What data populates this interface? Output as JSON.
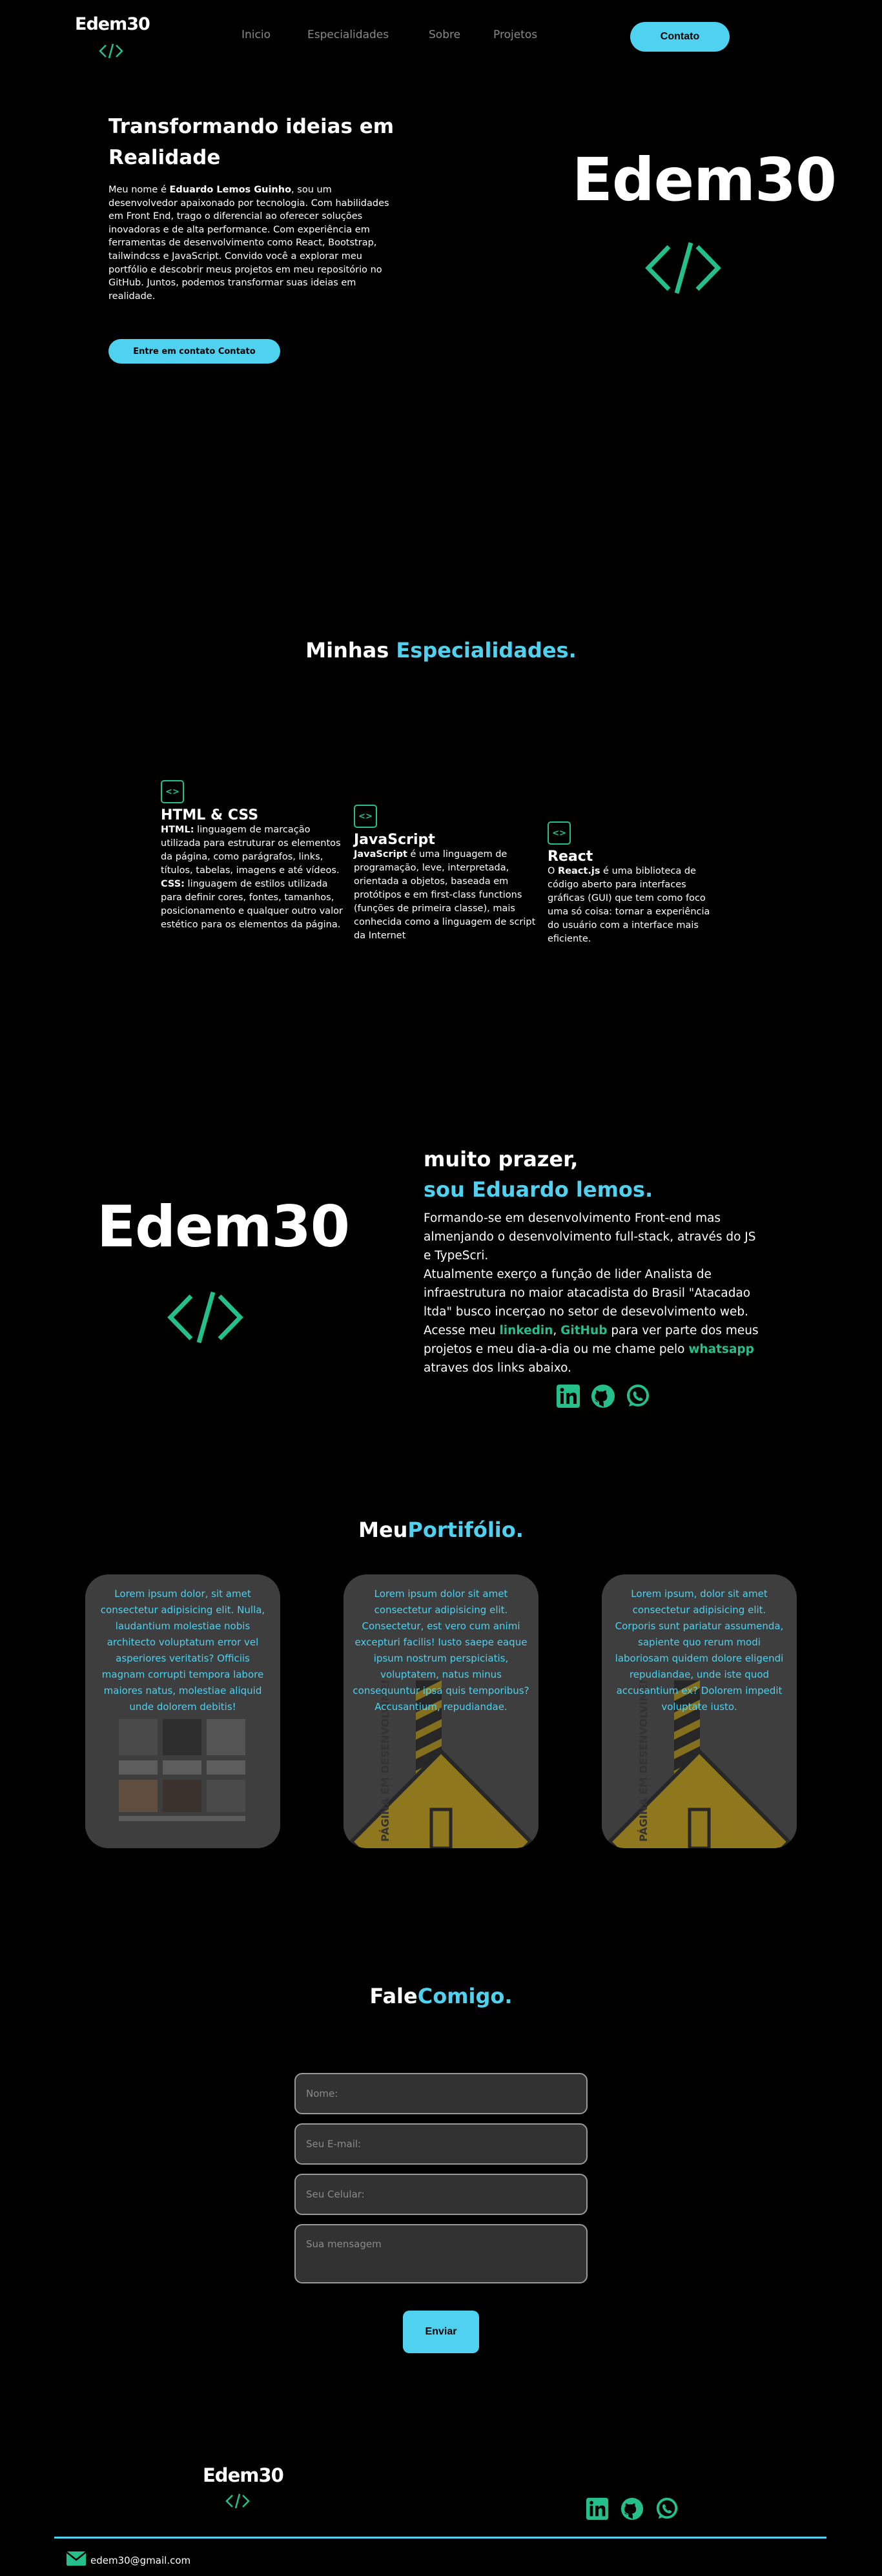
{
  "header": {
    "logo": "Edem30",
    "nav": [
      "Inicio",
      "Especialidades",
      "Sobre",
      "Projetos"
    ],
    "contact_button": "Contato"
  },
  "hero": {
    "title": "Transformando ideias em Realidade",
    "intro_prefix": "Meu nome é",
    "name": "Eduardo Lemos Guinho",
    "intro_rest": ", sou um desenvolvedor apaixonado por tecnologia. Com habilidades em Front End, trago o diferencial ao oferecer soluções inovadoras e de alta performance. Com experiência em ferramentas de desenvolvimento como React, Bootstrap, tailwindcss e JavaScript. Convido você a explorar meu portfólio e descobrir meus projetos em meu repositório no GitHub. Juntos, podemos transformar suas ideias em realidade.",
    "button": "Entre em contato Contato",
    "logo": "Edem30"
  },
  "specialties": {
    "title_white": "Minhas",
    "title_accent": "Especialidades.",
    "items": [
      {
        "icon": "code-icon",
        "title": "HTML & CSS",
        "p1_strong": "HTML:",
        "p1": " linguagem de marcação utilizada para estruturar os elementos da página, como parágrafos, links, títulos, tabelas, imagens e até vídeos.",
        "p2_strong": "CSS:",
        "p2": " linguagem de estilos utilizada para definir cores, fontes, tamanhos, posicionamento e qualquer outro valor estético para os elementos da página."
      },
      {
        "icon": "code-icon",
        "title": "JavaScript",
        "p1_strong": "JavaScript",
        "p1": " é uma linguagem de programação, leve, interpretada, orientada a objetos, baseada em protótipos e em first-class functions (funções de primeira classe), mais conhecida como a linguagem de script da Internet"
      },
      {
        "icon": "code-icon",
        "title": "React",
        "p1_pre": "O ",
        "p1_strong": "React.js",
        "p1": " é uma biblioteca de código aberto para interfaces gráficas (GUI) que tem como foco uma só coisa: tornar a experiência do usuário com a interface mais eficiente."
      }
    ]
  },
  "about": {
    "logo": "Edem30",
    "greeting": "muito prazer,",
    "name_line": "sou Eduardo lemos.",
    "text1": "Formando-se em desenvolvimento Front-end mas almenjando o desenvolvimento full-stack, através do JS e TypeScri.",
    "text2": "Atualmente exerço a função de lider Analista de infraestrutura no maior atacadista do Brasil \"Atacadao ltda\" busco incerçao no setor de desevolvimento web.",
    "text3_a": "Acesse meu ",
    "link_linkedin": "linkedin",
    "text3_b": ", ",
    "link_github": "GitHub",
    "text3_c": " para ver parte dos meus projetos e meu dia-a-dia ou me chame pelo ",
    "link_whatsapp": "whatsapp",
    "text3_d": " atraves dos links abaixo.",
    "social": [
      "linkedin-icon",
      "github-icon",
      "whatsapp-icon"
    ]
  },
  "portfolio": {
    "title_white": "Meu",
    "title_accent": "Portifólio.",
    "cards": [
      {
        "text": "Lorem ipsum dolor, sit amet consectetur adipisicing elit. Nulla, laudantium molestiae nobis architecto voluptatum error vel asperiores veritatis? Officiis magnam corrupti tempora labore maiores natus, molestiae aliquid unde dolorem debitis!"
      },
      {
        "text": "Lorem ipsum dolor sit amet consectetur adipisicing elit. Consectetur, est vero cum animi excepturi facilis! Iusto saepe eaque ipsum nostrum perspiciatis, voluptatem, natus minus consequuntur ipsa quis temporibus? Accusantium, repudiandae.",
        "sign": "PÁGINA EM DESENVOLVIMENTO"
      },
      {
        "text": "Lorem ipsum, dolor sit amet consectetur adipisicing elit. Corporis sunt pariatur assumenda, sapiente quo rerum modi laboriosam quidem dolore eligendi repudiandae, unde iste quod accusantium ex? Dolorem impedit voluptate iusto.",
        "sign": "PÁGINA EM DESENVOLVIMENTO"
      }
    ]
  },
  "contact": {
    "title_white": "Fale",
    "title_accent": "Comigo.",
    "name_placeholder": "Nome:",
    "email_placeholder": "Seu E-mail:",
    "phone_placeholder": "Seu Celular:",
    "message_placeholder": "Sua mensagem",
    "submit": "Enviar"
  },
  "footer": {
    "logo": "Edem30",
    "social": [
      "linkedin-icon",
      "github-icon",
      "whatsapp-icon"
    ],
    "email": "edem30@gmail.com"
  },
  "colors": {
    "accent": "#4fd1f0",
    "green": "#25c08a",
    "background": "#000000"
  }
}
